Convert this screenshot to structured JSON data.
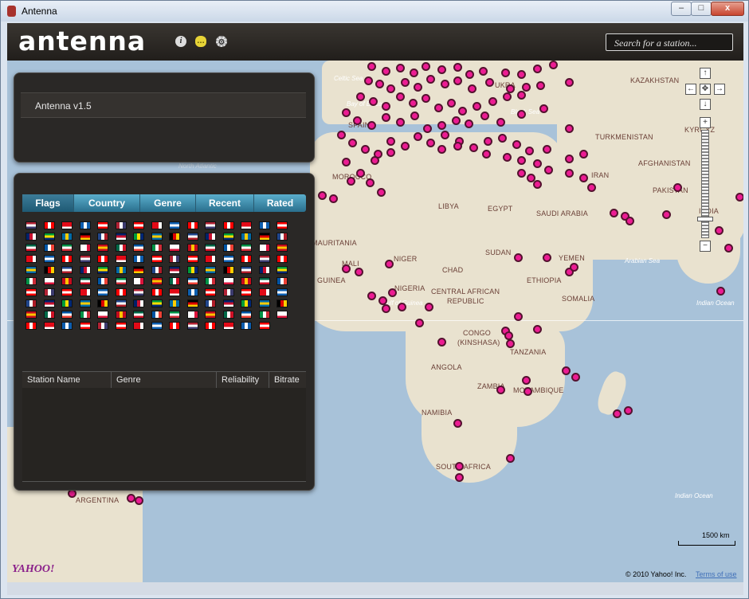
{
  "window": {
    "title": "Antenna",
    "min_label": "–",
    "max_label": "□",
    "close_label": "x"
  },
  "header": {
    "logo": "antenna",
    "info_icon": "info-icon",
    "chat_icon": "chat-icon",
    "gear_icon": "gear-icon",
    "search_placeholder": "Search for a station..."
  },
  "version_panel": {
    "label": "Antenna v1.5"
  },
  "tabs": [
    "Flags",
    "Country",
    "Genre",
    "Recent",
    "Rated"
  ],
  "table": {
    "columns": [
      "Station Name",
      "Genre",
      "Reliability",
      "Bitrate"
    ]
  },
  "map": {
    "labels": [
      "KAZAKHSTAN",
      "UKRA",
      "KYRGYZ",
      "TURKMENISTAN",
      "AFGHANISTAN",
      "PAKISTAN",
      "IRAN",
      "SAUDI ARABIA",
      "EGYPT",
      "LIBYA",
      "MOROCCO",
      "SPAIN",
      "CHAD",
      "NIGER",
      "SUDAN",
      "ETHIOPIA",
      "NIGERIA",
      "CENTRAL AFRICAN",
      "REPUBLIC",
      "SOMALIA",
      "CONGO",
      "(KINSHASA)",
      "TANZANIA",
      "ANGOLA",
      "ZAMBIA",
      "MOZAMBIQUE",
      "NAMIBIA",
      "SOUTH AFRICA",
      "YEMEN",
      "ARGENTINA",
      "INDIA",
      "GUINEA",
      "MALI",
      "MAURITANIA"
    ],
    "seas": [
      "Celtic Sea",
      "Bay of Biscay",
      "Black Sea",
      "Arabian Sea",
      "Indian Ocean",
      "Indian Ocean",
      "Gulf of Guinea",
      "North Atlantic"
    ],
    "provider": "YAHOO!",
    "copyright": "© 2010 Yahoo! Inc.",
    "terms": "Terms of use",
    "scale": "1500 km",
    "marker_color": "#ec1c93"
  }
}
